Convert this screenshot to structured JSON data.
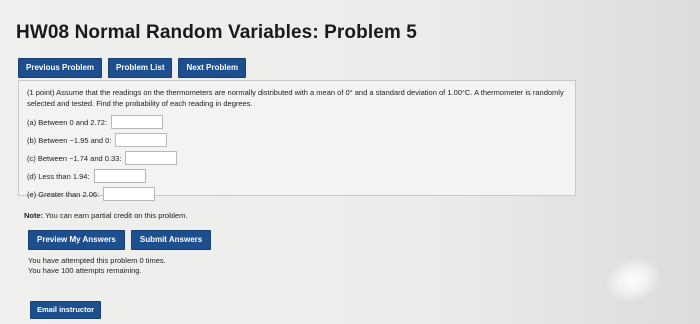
{
  "page": {
    "title": "HW08 Normal Random Variables: Problem 5"
  },
  "nav": {
    "previous": "Previous Problem",
    "list": "Problem List",
    "next": "Next Problem"
  },
  "problem": {
    "statement": "(1 point) Assume that the readings on the thermometers are normally distributed with a mean of 0° and a standard deviation of 1.00°C. A thermometer is randomly selected and tested. Find the probability of each reading in degrees.",
    "parts": [
      {
        "label": "(a)  Between 0 and 2.72:",
        "value": ""
      },
      {
        "label": "(b)  Between −1.95 and 0:",
        "value": ""
      },
      {
        "label": "(c)  Between −1.74 and 0.33:",
        "value": ""
      },
      {
        "label": "(d)  Less than 1.94:",
        "value": ""
      },
      {
        "label": "(e)  Greater than 2.06:",
        "value": ""
      }
    ]
  },
  "note": {
    "bold": "Note:",
    "text": " You can earn partial credit on this problem."
  },
  "actions": {
    "preview": "Preview My Answers",
    "submit": "Submit Answers"
  },
  "status": {
    "attempted": "You have attempted this problem 0 times.",
    "remaining": "You have 100 attempts remaining."
  },
  "email": {
    "label": "Email instructor"
  }
}
